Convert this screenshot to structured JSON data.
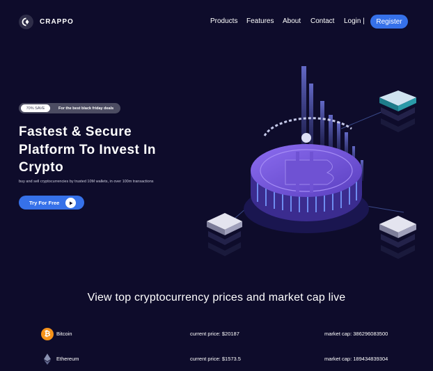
{
  "brand": {
    "name": "CRAPPO",
    "logo_icon": "crappo-logo-icon"
  },
  "nav": {
    "links": [
      "Products",
      "Features",
      "About",
      "Contact",
      "Login |"
    ],
    "register": "Register"
  },
  "hero": {
    "badge_pill": "70% SAVE",
    "badge_text": "For the best black friday deals",
    "title_line1": "Fastest & Secure",
    "title_line2": "Platform To Invest In",
    "title_line3": "Crypto",
    "subtitle": "buy and sell cryptocurrencies by trusted 10M wallets, in over 100m transactions",
    "cta": "Try For Free"
  },
  "market": {
    "title": "View top cryptocurrency prices and market cap live",
    "rows": [
      {
        "name": "Bitcoin",
        "price": "current price: $20187",
        "cap": "market cap: 386296083500",
        "icon": "bitcoin-icon",
        "color": "#f7931a"
      },
      {
        "name": "Ethereum",
        "price": "current price: $1573.5",
        "cap": "market cap: 189434839304",
        "icon": "ethereum-icon",
        "color": "#8a92b2"
      }
    ]
  },
  "colors": {
    "background": "#0e0c2b",
    "accent": "#3671e9",
    "illustration_purple": "#7556d8"
  }
}
